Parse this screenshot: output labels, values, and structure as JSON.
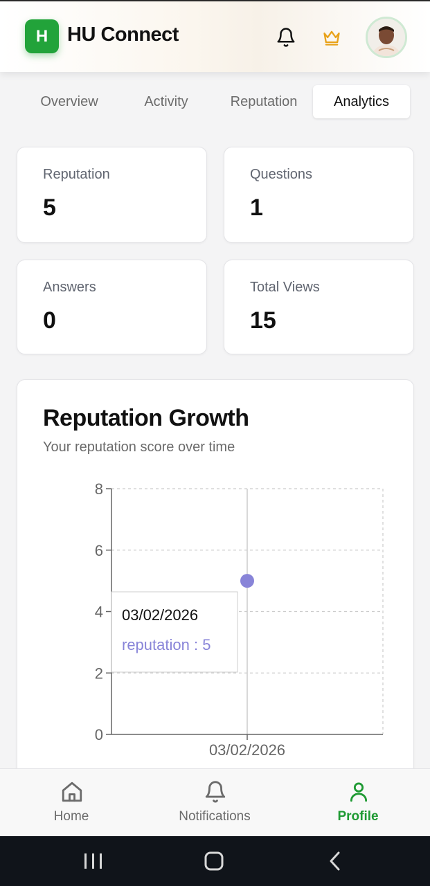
{
  "header": {
    "logo_letter": "H",
    "app_title": "HU Connect",
    "icons": [
      "bell-icon",
      "crown-icon",
      "avatar"
    ],
    "accent_color": "#22a33a",
    "crown_color": "#e8a21a"
  },
  "tabs": [
    {
      "label": "Overview"
    },
    {
      "label": "Activity"
    },
    {
      "label": "Reputation"
    },
    {
      "label": "Analytics",
      "active": true
    }
  ],
  "stats": [
    {
      "label": "Reputation",
      "value": "5"
    },
    {
      "label": "Questions",
      "value": "1"
    },
    {
      "label": "Answers",
      "value": "0"
    },
    {
      "label": "Total Views",
      "value": "15"
    }
  ],
  "chart": {
    "title": "Reputation Growth",
    "subtitle": "Your reputation score over time",
    "tooltip": {
      "date": "03/02/2026",
      "text": "reputation : 5"
    }
  },
  "chart_data": {
    "type": "line",
    "x": [
      "03/02/2026"
    ],
    "series": [
      {
        "name": "reputation",
        "values": [
          5
        ],
        "color": "#8884d8"
      }
    ],
    "y_ticks": [
      "0",
      "2",
      "4",
      "6",
      "8"
    ],
    "ylim": [
      0,
      8
    ],
    "grid": true,
    "title": "Reputation Growth",
    "subtitle": "Your reputation score over time"
  },
  "nav": [
    {
      "label": "Home",
      "icon": "home-icon"
    },
    {
      "label": "Notifications",
      "icon": "bell-icon"
    },
    {
      "label": "Profile",
      "icon": "user-icon",
      "active": true
    }
  ],
  "nav_active_color": "#1f9a33"
}
